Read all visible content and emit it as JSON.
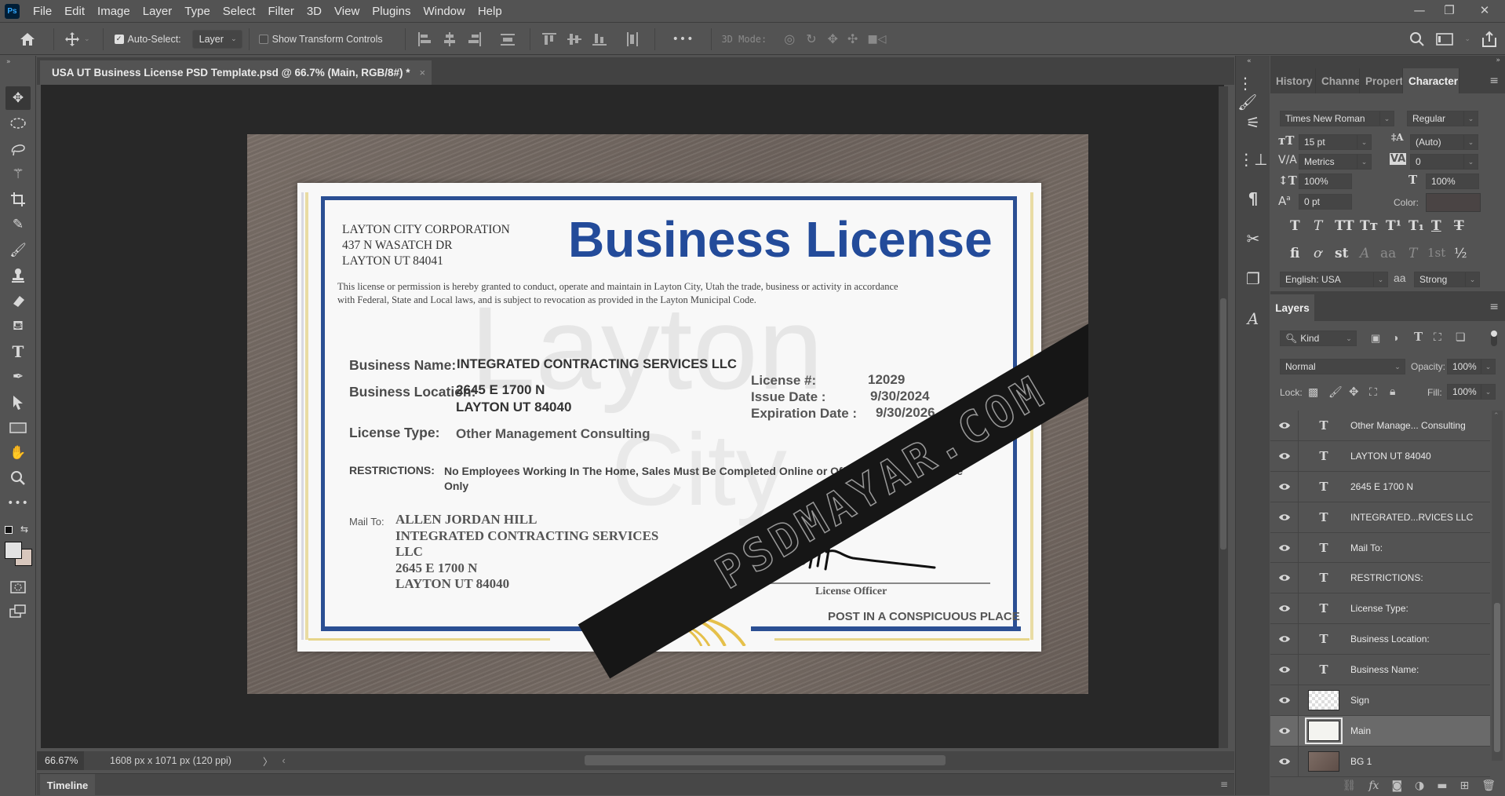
{
  "app": {
    "logo": "Ps"
  },
  "menu": [
    "File",
    "Edit",
    "Image",
    "Layer",
    "Type",
    "Select",
    "Filter",
    "3D",
    "View",
    "Plugins",
    "Window",
    "Help"
  ],
  "window_controls": {
    "minimize": "—",
    "restore": "❐",
    "close": "✕"
  },
  "options_bar": {
    "auto_select_label": "Auto-Select:",
    "auto_select_checked": true,
    "auto_select_target": "Layer",
    "show_transform_label": "Show Transform Controls",
    "show_transform_checked": false,
    "more_label": "•••",
    "mode_3d_label": "3D Mode:"
  },
  "document_tab": {
    "title": "USA UT Business License PSD Template.psd @ 66.7% (Main, RGB/8#) *",
    "close": "×"
  },
  "tools": [
    "move",
    "marquee",
    "lasso",
    "magic-wand",
    "crop",
    "eyedropper",
    "brush",
    "clone-stamp",
    "eraser",
    "paint-bucket",
    "type",
    "pen",
    "path-select",
    "rectangle",
    "hand",
    "zoom",
    "more"
  ],
  "colors": {
    "foreground": "#e2e2e2",
    "background": "#d8c7bd",
    "cert_blue": "#234b9a"
  },
  "certificate": {
    "corp_lines": [
      "LAYTON CITY CORPORATION",
      "437 N WASATCH DR",
      "LAYTON UT 84041"
    ],
    "title": "Business License",
    "paragraph_line1": "This license or permission is hereby granted to conduct, operate and maintain in Layton City, Utah the trade, business or activity in accordance",
    "paragraph_line2": "with Federal, State and Local laws, and is subject to revocation as provided in the Layton Municipal Code.",
    "business_name_label": "Business Name:",
    "business_name": "INTEGRATED CONTRACTING SERVICES LLC",
    "business_location_label": "Business Location:",
    "business_location_1": "2645 E 1700 N",
    "business_location_2": "LAYTON UT 84040",
    "license_type_label": "License Type:",
    "license_type": "Other Management Consulting",
    "license_no_label": "License #:",
    "license_no": "12029",
    "issue_date_label": "Issue Date :",
    "issue_date": "9/30/2024",
    "expiration_label": "Expiration Date :",
    "expiration_date": "9/30/2026",
    "restrictions_label": "RESTRICTIONS:",
    "restrictions": "No Employees Working In The Home, Sales Must Be Completed Online or Off Premise, Home Office Only",
    "mail_to_label": "Mail To:",
    "mail_lines": [
      "ALLEN JORDAN HILL",
      "INTEGRATED CONTRACTING SERVICES",
      "LLC",
      "2645 E 1700 N",
      "LAYTON UT 84040"
    ],
    "officer_label": "License Officer",
    "post_notice": "POST IN A CONSPICUOUS PLACE",
    "watermark_city_1": "Layton",
    "watermark_city_2": "City",
    "banner_text": "PSDMAYAR.COM"
  },
  "status": {
    "zoom": "66.67%",
    "doc_info": "1608 px x 1071 px (120 ppi)",
    "arrow": "〉",
    "scroll_left": "‹"
  },
  "timeline": {
    "label": "Timeline"
  },
  "panel_tabs": [
    "History",
    "Channel",
    "Propert",
    "Character"
  ],
  "active_panel_tab": "Character",
  "character": {
    "font_family": "Times New Roman",
    "font_style": "Regular",
    "size": "15 pt",
    "leading": "(Auto)",
    "kerning": "Metrics",
    "tracking": "0",
    "vertical_scale": "100%",
    "horizontal_scale": "100%",
    "baseline_shift": "0 pt",
    "color_label": "Color:",
    "color": "#4a4444",
    "style_buttons": [
      "T",
      "T",
      "TT",
      "Tт",
      "T¹",
      "T₁",
      "T",
      "T"
    ],
    "opentype_buttons": [
      "fi",
      "ơ",
      "st",
      "A",
      "aa",
      "T",
      "1st",
      "½"
    ],
    "language": "English: USA",
    "antialias_icon": "aa",
    "antialias": "Strong"
  },
  "layers": {
    "title": "Layers",
    "filter_kind": "Kind",
    "blend_mode": "Normal",
    "opacity_label": "Opacity:",
    "opacity": "100%",
    "lock_label": "Lock:",
    "fill_label": "Fill:",
    "fill": "100%",
    "items": [
      {
        "name": "Other Manage... Consulting",
        "type": "text",
        "visible": true,
        "selected": false
      },
      {
        "name": "LAYTON UT 84040",
        "type": "text",
        "visible": true,
        "selected": false
      },
      {
        "name": "2645 E 1700 N",
        "type": "text",
        "visible": true,
        "selected": false
      },
      {
        "name": "INTEGRATED...RVICES LLC",
        "type": "text",
        "visible": true,
        "selected": false
      },
      {
        "name": "Mail To:",
        "type": "text",
        "visible": true,
        "selected": false
      },
      {
        "name": "RESTRICTIONS:",
        "type": "text",
        "visible": true,
        "selected": false
      },
      {
        "name": "License Type:",
        "type": "text",
        "visible": true,
        "selected": false
      },
      {
        "name": "Business Location:",
        "type": "text",
        "visible": true,
        "selected": false
      },
      {
        "name": "Business Name:",
        "type": "text",
        "visible": true,
        "selected": false
      },
      {
        "name": "Sign",
        "type": "transparent",
        "visible": true,
        "selected": false
      },
      {
        "name": "Main",
        "type": "white",
        "visible": true,
        "selected": true
      },
      {
        "name": "BG 1",
        "type": "wood",
        "visible": true,
        "selected": false
      }
    ]
  }
}
